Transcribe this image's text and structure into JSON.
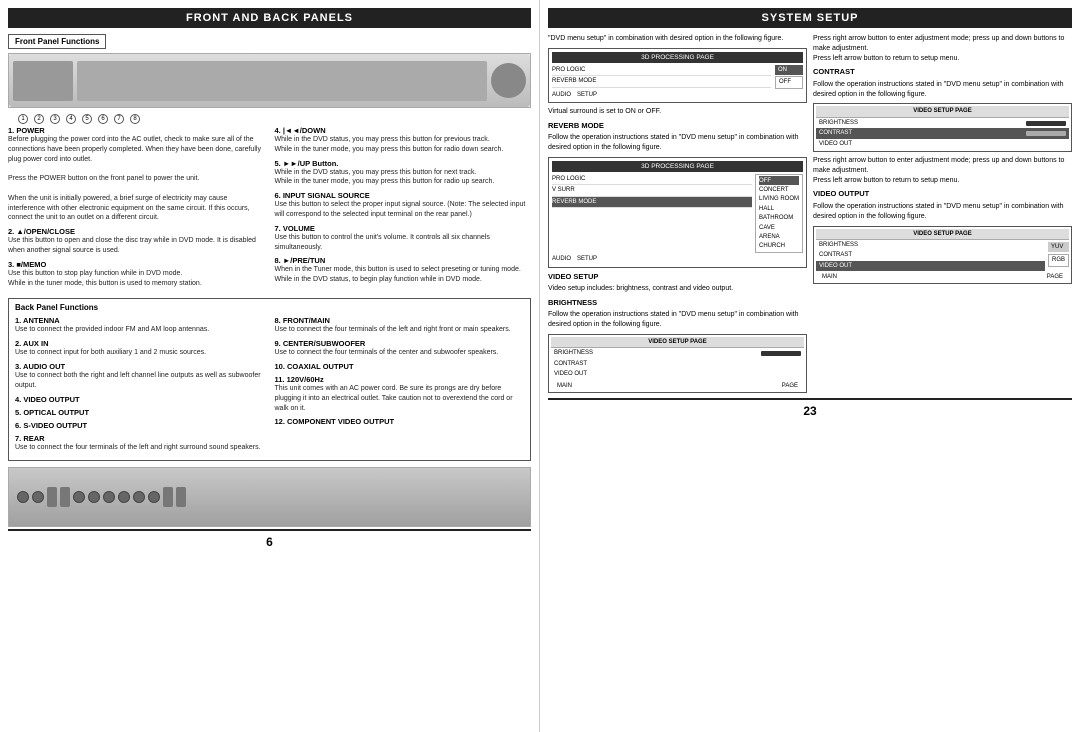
{
  "left": {
    "header": "FRONT AND BACK PANELS",
    "front_panel_box": "Front Panel Functions",
    "front_numbers": [
      "1",
      "2",
      "3",
      "4",
      "5",
      "6",
      "7"
    ],
    "front_numbers2": [
      "1",
      "2",
      "3",
      "4",
      "5"
    ],
    "front_items": [
      {
        "title": "1. POWER",
        "body": "Before plugging the power cord into the AC outlet, check to make sure all of the connections have been properly completed. When they have been done, carefully plug power cord into outlet.\nPress the POWER button on the front panel to power the unit.\nWhen the unit is initially powered, a brief surge of electricity may cause interference with other electronic equipment on the same circuit. If this occurs, connect the unit to an outlet on a different circuit."
      },
      {
        "title": "4. |◄◄/DOWN",
        "body": "While in the DVD status, you may press this button for previous track.\nWhile in the tuner mode, you may press this button for radio down search."
      },
      {
        "title": "5. ►► /UP Button.",
        "body": "While in the DVD status, you may press this button for next track.\nWhile in the tuner mode, you may press this button for radio up search."
      },
      {
        "title": "2. ▲/OPEN/CLOSE",
        "body": "Use this button to open and close the disc tray while in DVD mode. It is disabled when another signal source is used."
      },
      {
        "title": "6. INPUT SIGNAL SOURCE",
        "body": "Use this button to select the proper input signal source. (Note: The selected input will correspond to the selected input terminal on the rear panel.)"
      },
      {
        "title": "3. ■/MEMO",
        "body": "Use this button to stop play function while in DVD mode.\nWhile in the tuner mode, this button is used to memory station."
      },
      {
        "title": "7. VOLUME",
        "body": "Use this button to control the unit's volume. It controls all six channels simultaneously."
      },
      {
        "title": "8. ►/PRE/TUN",
        "body": "When in the Tuner mode, this button is used to select preseting or tuning mode.\nWhile in the DVD status, to begin play function while in DVD mode."
      }
    ],
    "back_panel_box": "Back Panel Functions",
    "back_items_left": [
      {
        "title": "1. ANTENNA",
        "body": "Use to connect the provided indoor FM and AM loop antennas."
      },
      {
        "title": "2. AUX IN",
        "body": "Use to connect input for both auxiliary 1 and 2 music sources."
      },
      {
        "title": "3. AUDIO OUT",
        "body": "Use to connect both the right and left channel line outputs as well as subwoofer output."
      },
      {
        "title": "4. VIDEO OUTPUT",
        "body": ""
      },
      {
        "title": "5. OPTICAL OUTPUT",
        "body": ""
      },
      {
        "title": "6. S-VIDEO OUTPUT",
        "body": ""
      },
      {
        "title": "7. REAR",
        "body": "Use to connect the four terminals of the left and right surround sound speakers."
      }
    ],
    "back_items_right": [
      {
        "title": "8. FRONT/MAIN",
        "body": "Use to connect the four terminals of the left and right front or main speakers."
      },
      {
        "title": "9. CENTER/SUBWOOFER",
        "body": "Use to connect the four terminals of the center and subwoofer speakers."
      },
      {
        "title": "10. COAXIAL OUTPUT",
        "body": ""
      },
      {
        "title": "11. 120V/60Hz",
        "body": "This unit comes with an AC power cord. Be sure its prongs are dry before plugging it into an electrical outlet. Take caution not to overextend the cord or walk on it."
      },
      {
        "title": "12. COMPONENT VIDEO OUTPUT",
        "body": ""
      }
    ],
    "page_num": "6"
  },
  "right": {
    "header": "SYSTEM SETUP",
    "page_num": "23",
    "col1": {
      "intro": "\"DVD menu setup\" in combination with desired option in the following figure.",
      "box1_title": "3D PROCESSING PAGE",
      "box1_rows": [
        {
          "label": "PRO LOGIC",
          "value": ""
        },
        {
          "label": "REVERB MODE",
          "value": "ON"
        },
        {
          "label": "",
          "value": "OFF"
        }
      ],
      "virtual_text": "Virtual surround is set to ON or OFF.",
      "reverb_title": "REVERB MODE",
      "reverb_text": "Follow the operation instructions stated in \"DVD menu setup\" in combination with desired option in the following figure.",
      "box2_title": "3D PROCESSING PAGE",
      "box2_rows": [
        {
          "label": "PRO LOGIC",
          "value": ""
        },
        {
          "label": "V SURR",
          "value": ""
        },
        {
          "label": "REVERB MODE",
          "value": "OFF",
          "active": true
        }
      ],
      "box2_list": [
        "OFF",
        "CONCERT",
        "LIVING ROOM",
        "HALL",
        "BATHROOM",
        "CAVE",
        "ARENA",
        "CHURCH"
      ],
      "box2_bottom": [
        "AUDIO",
        "SETUP"
      ],
      "video_setup_title": "VIDEO SETUP",
      "video_setup_text": "Video setup includes: brightness, contrast and video output.",
      "brightness_title": "BRIGHTNESS",
      "brightness_text": "Follow the operation instructions stated in \"DVD menu setup\" in combination with desired option in the following figure.",
      "box3_title": "VIDEO SETUP PAGE",
      "box3_rows": [
        "BRIGHTNESS",
        "CONTRAST",
        "VIDEO OUT"
      ],
      "box3_bottom": [
        "MAIN",
        "PAGE"
      ]
    },
    "col2": {
      "intro": "Press right arrow button to enter adjustment mode; press up and down buttons to make adjustment.\nPress left arrow button to return to setup menu.",
      "contrast_title": "CONTRAST",
      "contrast_text": "Follow the operation instructions stated in \"DVD menu setup\" in combination with desired option in the following figure.",
      "box1_title": "VIDEO SETUP PAGE",
      "box1_rows": [
        "BRIGHTNESS",
        "CONTRAST",
        "VIDEO OUT"
      ],
      "intro2": "Press right arrow button to enter adjustment mode; press up and down buttons to make adjustment.\nPress left arrow button to return to setup menu.",
      "video_output_title": "VIDEO OUTPUT",
      "video_output_text": "Follow the operation instructions stated in \"DVD menu setup\" in combination with desired option in the following figure.",
      "box2_title": "VIDEO SETUP PAGE",
      "box2_rows": [
        {
          "label": "BRIGHTNESS",
          "value": ""
        },
        {
          "label": "CONTRAST",
          "value": ""
        },
        {
          "label": "VIDEO OUT",
          "value": "",
          "active": true
        }
      ],
      "box2_options": [
        "YUV",
        "RGB"
      ],
      "box2_bottom": [
        "MAIN",
        "PAGE"
      ]
    }
  }
}
